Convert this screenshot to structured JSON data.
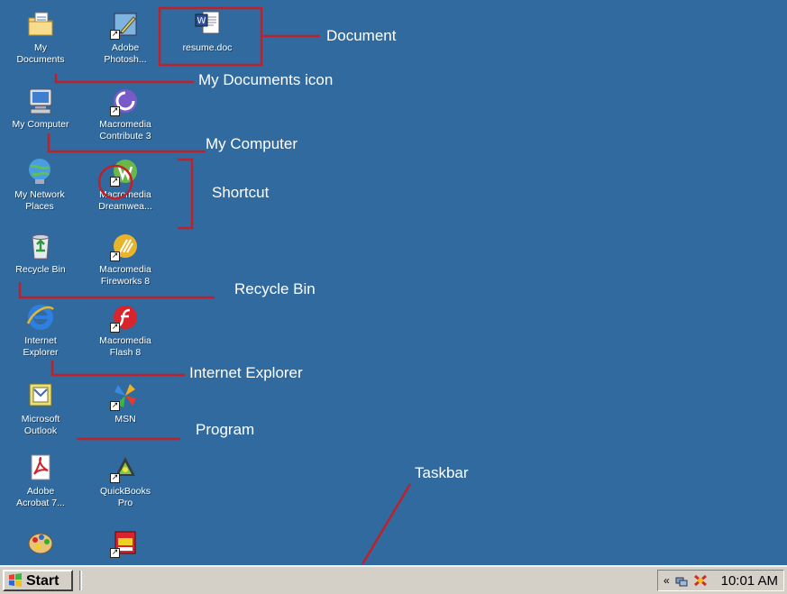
{
  "desktop": {
    "icons": [
      {
        "label": "My\nDocuments",
        "icon": "folder-doc-icon"
      },
      {
        "label": "Adobe\nPhotosh...",
        "icon": "photoshop-icon"
      },
      {
        "label": "resume.doc",
        "icon": "word-doc-icon"
      },
      {
        "label": "My Computer",
        "icon": "computer-icon"
      },
      {
        "label": "Macromedia\nContribute 3",
        "icon": "contribute-icon"
      },
      {
        "label": "My Network\nPlaces",
        "icon": "network-icon"
      },
      {
        "label": "Macromedia\nDreamwea...",
        "icon": "dreamweaver-icon"
      },
      {
        "label": "Recycle Bin",
        "icon": "recycle-bin-icon"
      },
      {
        "label": "Macromedia\nFireworks 8",
        "icon": "fireworks-icon"
      },
      {
        "label": "Internet\nExplorer",
        "icon": "ie-icon"
      },
      {
        "label": "Macromedia\nFlash 8",
        "icon": "flash-icon"
      },
      {
        "label": "Microsoft\nOutlook",
        "icon": "outlook-icon"
      },
      {
        "label": "MSN",
        "icon": "msn-icon"
      },
      {
        "label": "Adobe\nAcrobat 7...",
        "icon": "acrobat-icon"
      },
      {
        "label": "QuickBooks\nPro",
        "icon": "quickbooks-icon"
      }
    ]
  },
  "callouts": {
    "document": "Document",
    "my_documents": "My Documents icon",
    "my_computer": "My Computer",
    "shortcut": "Shortcut",
    "recycle_bin": "Recycle Bin",
    "internet_explorer": "Internet Explorer",
    "program": "Program",
    "taskbar": "Taskbar"
  },
  "taskbar": {
    "start_label": "Start",
    "clock": "10:01 AM"
  },
  "colors": {
    "desktop": "#306a9e",
    "annotation": "#c0202a",
    "taskbar": "#d4d0c8"
  }
}
